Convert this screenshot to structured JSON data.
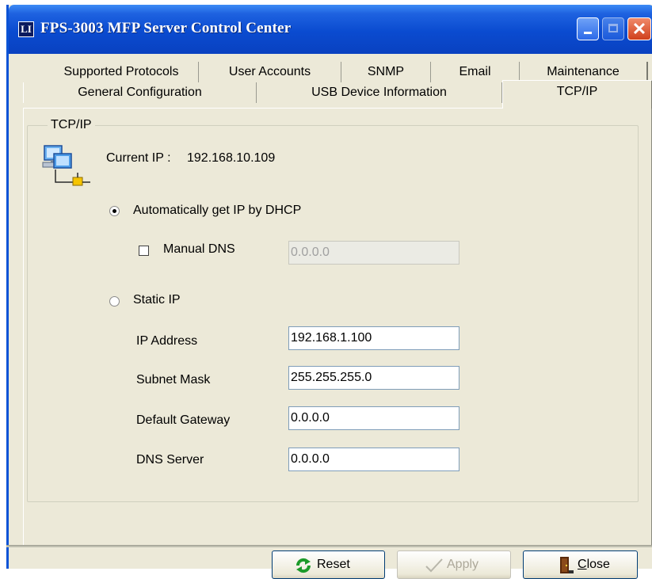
{
  "window": {
    "title": "FPS-3003 MFP Server Control Center",
    "icon_text": "LI",
    "close_glyph": "✕"
  },
  "tabs": {
    "back_row": [
      "Supported Protocols",
      "User Accounts",
      "SNMP",
      "Email",
      "Maintenance"
    ],
    "front_row": [
      "General Configuration",
      "USB Device Information",
      "TCP/IP"
    ],
    "selected": "TCP/IP"
  },
  "group": {
    "title": "TCP/IP"
  },
  "current_ip": {
    "label": "Current IP :",
    "value": "192.168.10.109"
  },
  "dhcp": {
    "label": "Automatically get IP by DHCP",
    "selected": true
  },
  "manual_dns": {
    "label": "Manual DNS",
    "checked": false,
    "value": "0.0.0.0",
    "enabled": false
  },
  "static_ip": {
    "label": "Static IP",
    "selected": false,
    "fields": [
      {
        "label": "IP Address",
        "value": "192.168.1.100"
      },
      {
        "label": "Subnet Mask",
        "value": "255.255.255.0"
      },
      {
        "label": "Default Gateway",
        "value": "0.0.0.0"
      },
      {
        "label": "DNS Server",
        "value": "0.0.0.0"
      }
    ]
  },
  "buttons": {
    "reset": "Reset",
    "apply": "Apply",
    "close_prefix": "C",
    "close_rest": "lose"
  },
  "colors": {
    "titlebar": "#0a4bd0",
    "dialog_bg": "#ece9d8",
    "close_button": "#d0401c",
    "reset_icon": "#1c9a2a"
  },
  "icons": {
    "network": "network-computer-icon",
    "reset": "refresh-icon",
    "apply": "checkmark-icon",
    "close": "door-icon"
  }
}
